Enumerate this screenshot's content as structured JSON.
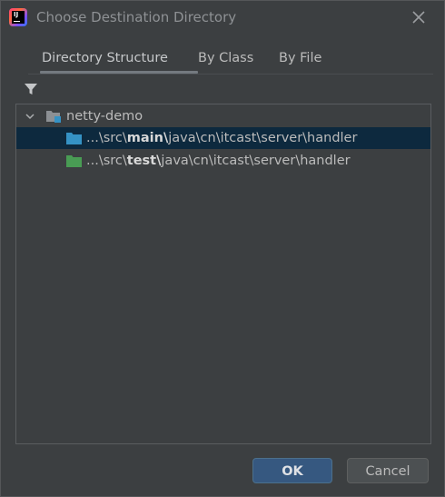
{
  "window": {
    "title": "Choose Destination Directory"
  },
  "tabs": [
    {
      "label": "Directory Structure",
      "selected": true
    },
    {
      "label": "By Class",
      "selected": false
    },
    {
      "label": "By File",
      "selected": false
    }
  ],
  "tree": {
    "root": {
      "label": "netty-demo",
      "expanded": true
    },
    "items": [
      {
        "prefix": "...\\src\\",
        "bold": "main\\",
        "suffix": "java\\cn\\itcast\\server\\handler",
        "folder_color": "#3592c4",
        "selected": true
      },
      {
        "prefix": "...\\src\\",
        "bold": "test\\",
        "suffix": "java\\cn\\itcast\\server\\handler",
        "folder_color": "#499c54",
        "selected": false
      }
    ]
  },
  "buttons": {
    "ok": "OK",
    "cancel": "Cancel"
  },
  "icons": {
    "app": "intellij-idea-icon",
    "close": "close-icon",
    "filter": "filter-icon",
    "expand": "chevron-down-icon",
    "project": "project-module-icon",
    "folder": "folder-icon"
  },
  "colors": {
    "background": "#3c3f41",
    "selection": "#0d293e",
    "primary_button": "#365880"
  }
}
